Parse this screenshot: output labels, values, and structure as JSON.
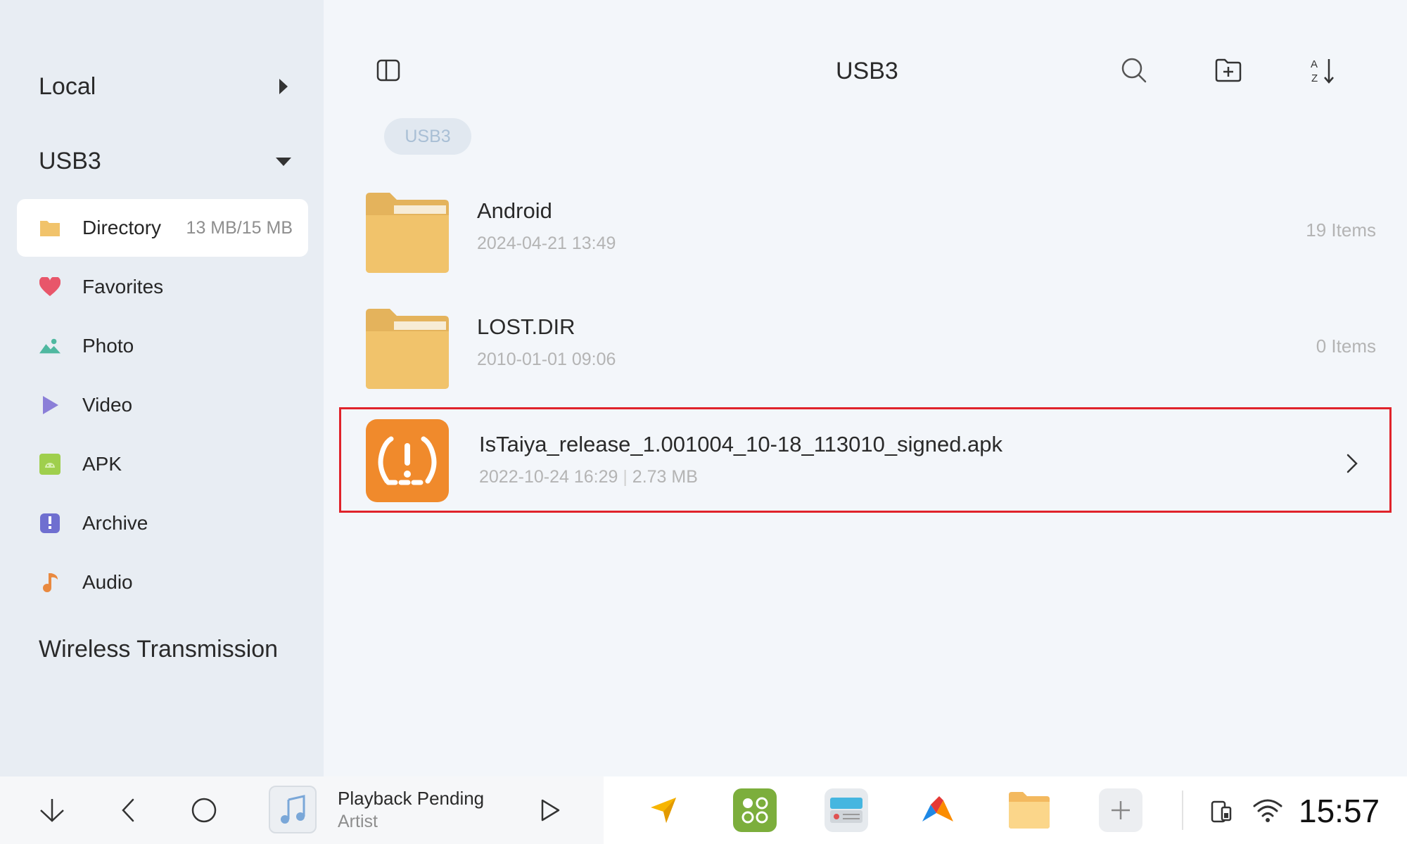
{
  "sidebar": {
    "local_label": "Local",
    "usb_label": "USB3",
    "items": [
      {
        "label": "Directory",
        "meta": "13 MB/15 MB",
        "icon": "folder-icon"
      },
      {
        "label": "Favorites",
        "icon": "heart-icon"
      },
      {
        "label": "Photo",
        "icon": "photo-icon"
      },
      {
        "label": "Video",
        "icon": "video-icon"
      },
      {
        "label": "APK",
        "icon": "android-icon"
      },
      {
        "label": "Archive",
        "icon": "archive-icon"
      },
      {
        "label": "Audio",
        "icon": "music-note-icon"
      }
    ],
    "wireless_label": "Wireless Transmission"
  },
  "header": {
    "title": "USB3",
    "breadcrumb": "USB3"
  },
  "files": [
    {
      "name": "Android",
      "date": "2024-04-21 13:49",
      "count": "19 Items",
      "type": "folder"
    },
    {
      "name": "LOST.DIR",
      "date": "2010-01-01 09:06",
      "count": "0 Items",
      "type": "folder"
    },
    {
      "name": "IsTaiya_release_1.001004_10-18_113010_signed.apk",
      "date": "2022-10-24 16:29",
      "size": "2.73 MB",
      "type": "apk"
    }
  ],
  "taskbar": {
    "media_title": "Playback Pending",
    "media_artist": "Artist",
    "clock": "15:57"
  },
  "colors": {
    "highlight": "#e0232b",
    "folder": "#f1c36b",
    "apk_bg": "#f08a2c"
  }
}
